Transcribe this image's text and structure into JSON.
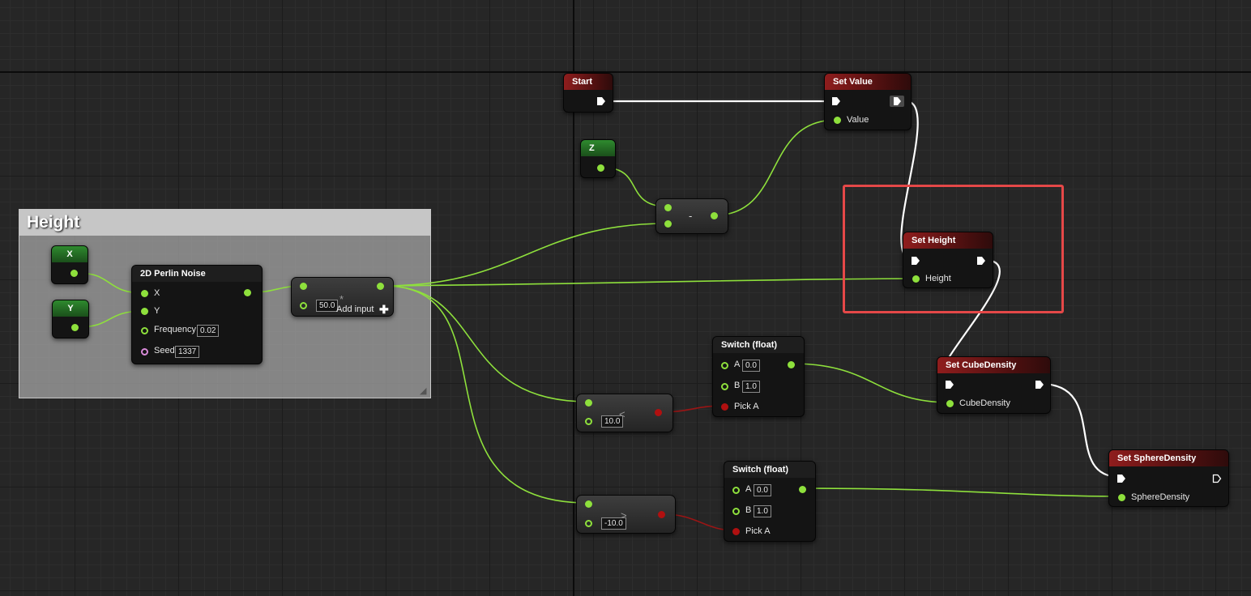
{
  "comment_box": {
    "title": "Height"
  },
  "nodes": {
    "x": {
      "title": "X"
    },
    "y": {
      "title": "Y"
    },
    "z": {
      "title": "Z"
    },
    "perlin": {
      "title": "2D Perlin Noise",
      "pin_x": "X",
      "pin_y": "Y",
      "frequency_label": "Frequency",
      "frequency_value": "0.02",
      "seed_label": "Seed",
      "seed_value": "1337"
    },
    "multiply": {
      "symbol": "*",
      "b_value": "50.0",
      "add_input_label": "Add input"
    },
    "subtract": {
      "symbol": "-"
    },
    "start": {
      "title": "Start"
    },
    "set_value": {
      "title": "Set Value",
      "pin_label": "Value"
    },
    "set_height": {
      "title": "Set Height",
      "pin_label": "Height"
    },
    "less": {
      "symbol": "<",
      "b_value": "10.0"
    },
    "greater": {
      "symbol": ">",
      "b_value": "-10.0"
    },
    "switch1": {
      "title": "Switch (float)",
      "a_label": "A",
      "a_value": "0.0",
      "b_label": "B",
      "b_value": "1.0",
      "pick_label": "Pick A"
    },
    "switch2": {
      "title": "Switch (float)",
      "a_label": "A",
      "a_value": "0.0",
      "b_label": "B",
      "b_value": "1.0",
      "pick_label": "Pick A"
    },
    "set_cube": {
      "title": "Set CubeDensity",
      "pin_label": "CubeDensity"
    },
    "set_sphere": {
      "title": "Set SphereDensity",
      "pin_label": "SphereDensity"
    }
  },
  "colors": {
    "float_pin": "#8ee03c",
    "bool_pin": "#b01010",
    "int_pin": "#d98bd9",
    "exec_wire": "#ffffff",
    "selection": "#e54848"
  }
}
